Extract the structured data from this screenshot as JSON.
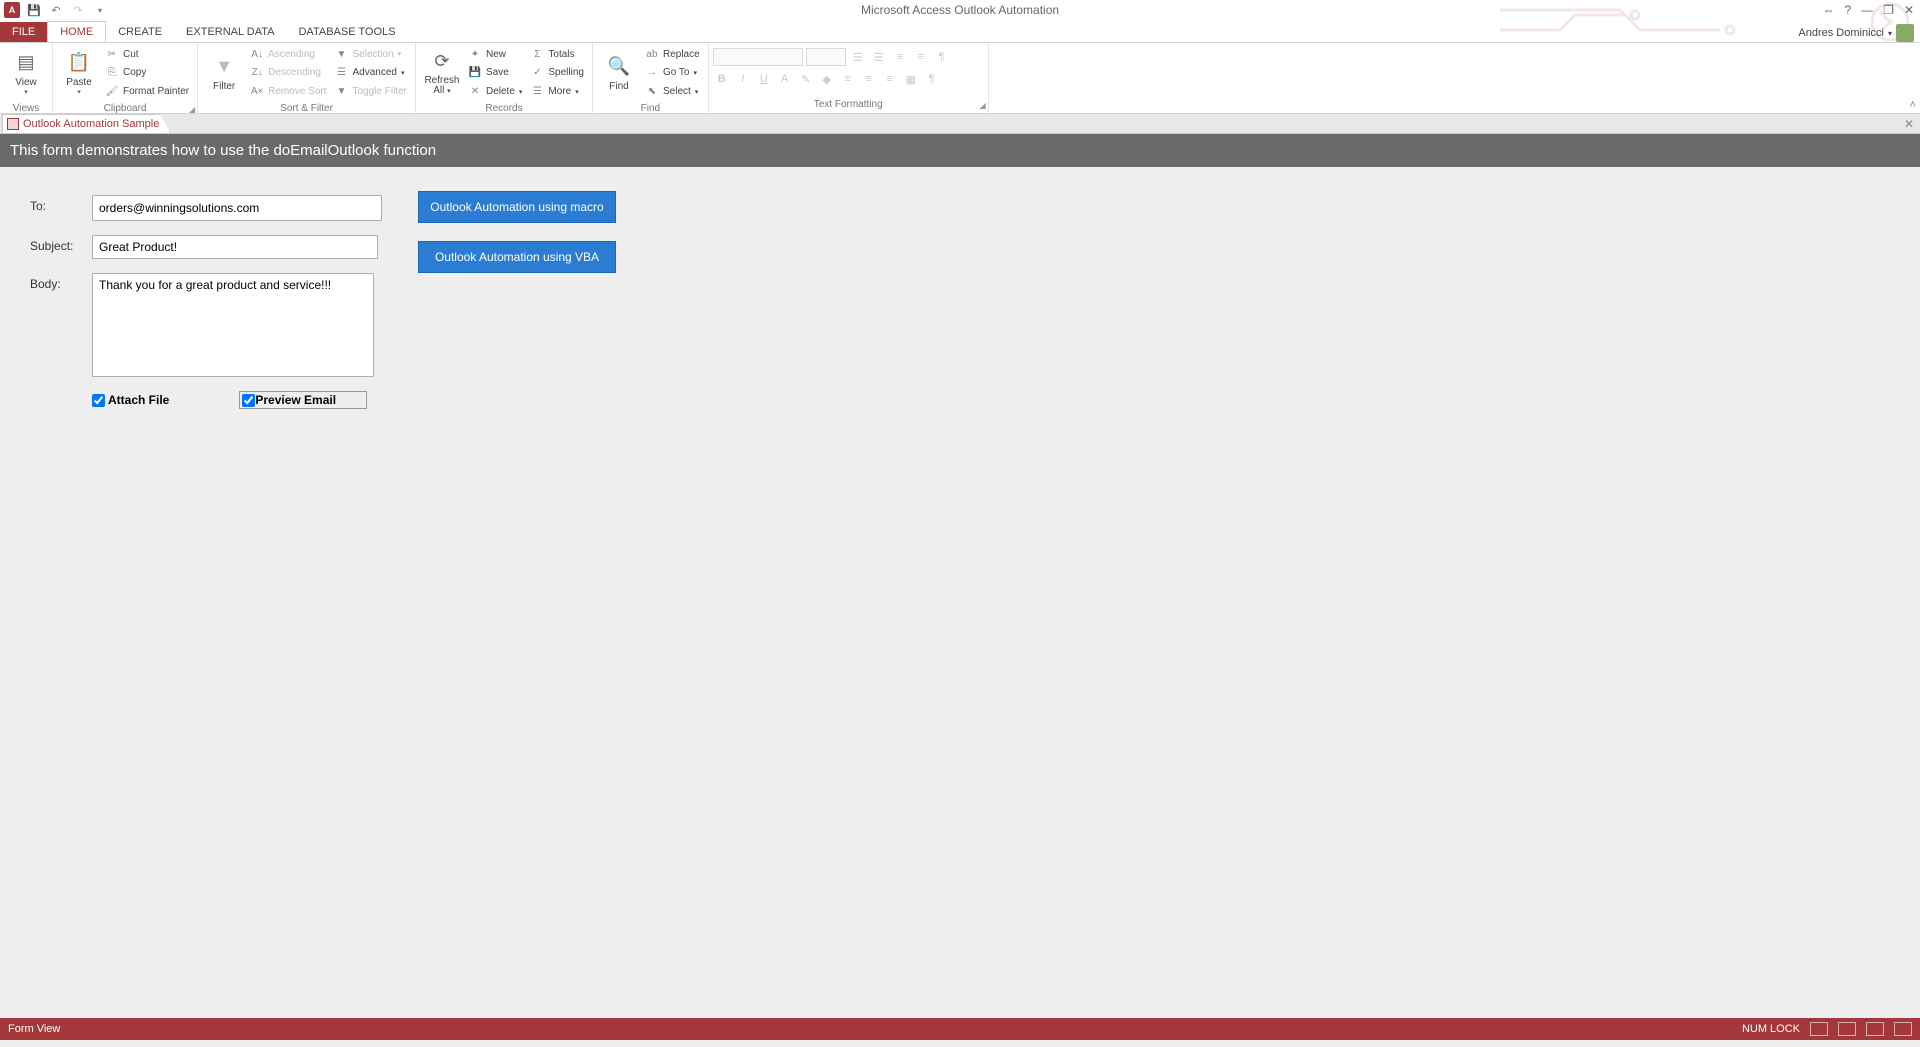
{
  "app_title": "Microsoft Access Outlook Automation",
  "user_name": "Andres Dominicci",
  "tabs": {
    "file": "FILE",
    "home": "HOME",
    "create": "CREATE",
    "external": "EXTERNAL DATA",
    "dbtools": "DATABASE TOOLS"
  },
  "ribbon": {
    "views": {
      "view": "View",
      "label": "Views"
    },
    "clipboard": {
      "paste": "Paste",
      "cut": "Cut",
      "copy": "Copy",
      "format_painter": "Format Painter",
      "label": "Clipboard"
    },
    "sortfilter": {
      "filter": "Filter",
      "asc": "Ascending",
      "desc": "Descending",
      "remove": "Remove Sort",
      "selection": "Selection",
      "advanced": "Advanced",
      "toggle": "Toggle Filter",
      "label": "Sort & Filter"
    },
    "records": {
      "refresh": "Refresh All",
      "new": "New",
      "save": "Save",
      "delete": "Delete",
      "totals": "Totals",
      "spelling": "Spelling",
      "more": "More",
      "label": "Records"
    },
    "find": {
      "find": "Find",
      "replace": "Replace",
      "goto": "Go To",
      "select": "Select",
      "label": "Find"
    },
    "textfmt": {
      "label": "Text Formatting"
    }
  },
  "doc_tab": "Outlook Automation Sample",
  "form_header": "This form demonstrates how to use the doEmailOutlook function",
  "form": {
    "to_label": "To:",
    "to_value": "orders@winningsolutions.com",
    "subject_label": "Subject:",
    "subject_value": "Great Product!",
    "body_label": "Body:",
    "body_value": "Thank you for a great product and service!!!",
    "attach_label": "Attach File",
    "preview_label": "Preview Email",
    "attach_checked": true,
    "preview_checked": true
  },
  "buttons": {
    "macro": "Outlook Automation using macro",
    "vba": "Outlook Automation using VBA"
  },
  "status": {
    "left": "Form View",
    "numlock": "NUM LOCK"
  }
}
